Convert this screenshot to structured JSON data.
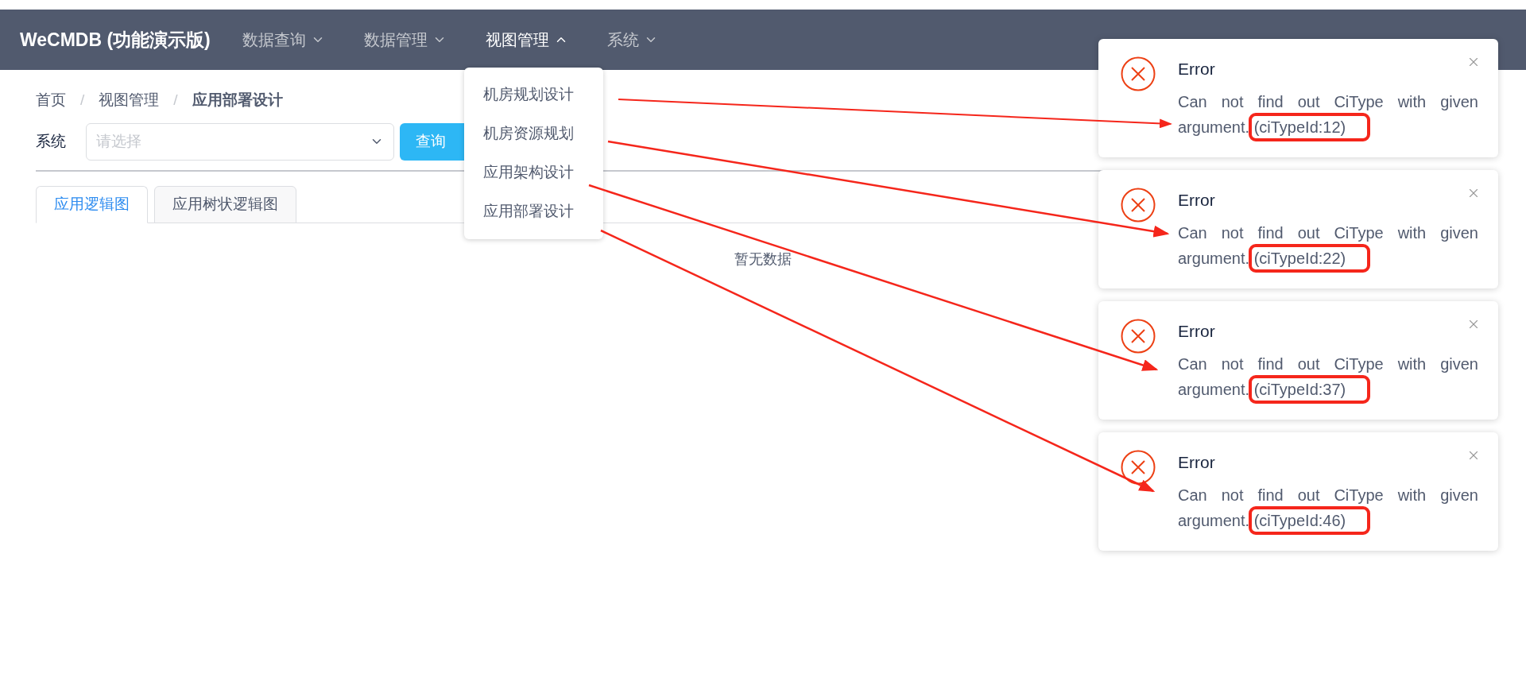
{
  "header": {
    "title": "WeCMDB (功能演示版)",
    "menu": [
      {
        "label": "数据查询",
        "expanded": false
      },
      {
        "label": "数据管理",
        "expanded": false
      },
      {
        "label": "视图管理",
        "expanded": true,
        "submenu": [
          "机房规划设计",
          "机房资源规划",
          "应用架构设计",
          "应用部署设计"
        ]
      },
      {
        "label": "系统",
        "expanded": false
      }
    ]
  },
  "breadcrumb": [
    {
      "kind": "link",
      "label": "首页"
    },
    {
      "kind": "separator",
      "label": "/"
    },
    {
      "kind": "link",
      "label": "视图管理"
    },
    {
      "kind": "separator",
      "label": "/"
    },
    {
      "kind": "current",
      "label": "应用部署设计"
    }
  ],
  "filter": {
    "label": "系统",
    "placeholder": "请选择",
    "button": "查询"
  },
  "tabs": [
    {
      "label": "应用逻辑图",
      "selected": true
    },
    {
      "label": "应用树状逻辑图",
      "selected": false
    }
  ],
  "empty_text": "暂无数据",
  "notifications": [
    {
      "title": "Error",
      "message": "Can not find out CiType with given argument.",
      "highlight": "(ciTypeId:12)"
    },
    {
      "title": "Error",
      "message": "Can not find out CiType with given argument.",
      "highlight": "(ciTypeId:22)"
    },
    {
      "title": "Error",
      "message": "Can not find out CiType with given argument.",
      "highlight": "(ciTypeId:37)"
    },
    {
      "title": "Error",
      "message": "Can not find out CiType with given argument.",
      "highlight": "(ciTypeId:46)"
    }
  ]
}
